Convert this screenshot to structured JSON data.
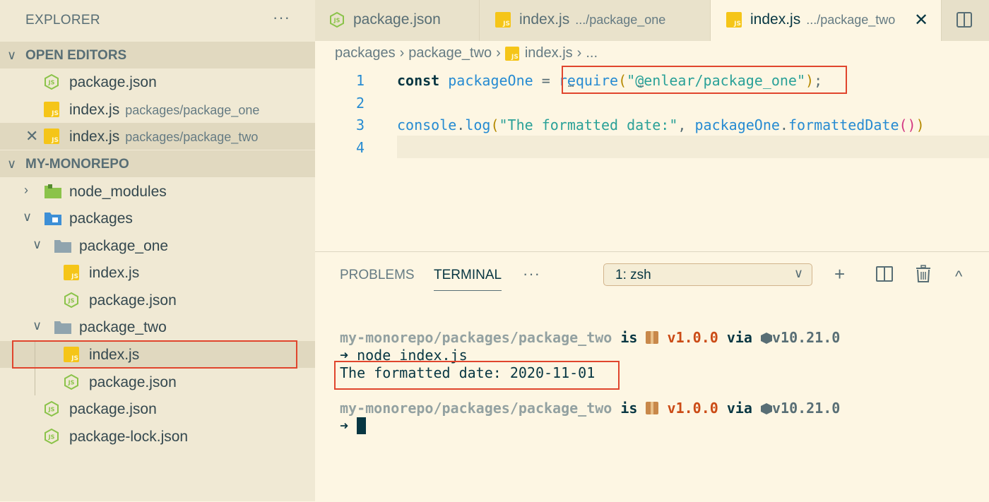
{
  "sidebar": {
    "title": "EXPLORER",
    "more": "···",
    "open_editors": {
      "label": "OPEN EDITORS",
      "items": [
        {
          "name": "package.json",
          "desc": ""
        },
        {
          "name": "index.js",
          "desc": "packages/package_one"
        },
        {
          "name": "index.js",
          "desc": "packages/package_two",
          "close": "✕"
        }
      ]
    },
    "workspace": {
      "label": "MY-MONOREPO",
      "items": {
        "node_modules": "node_modules",
        "packages": "packages",
        "package_one": "package_one",
        "p1_index": "index.js",
        "p1_package": "package.json",
        "package_two": "package_two",
        "p2_index": "index.js",
        "p2_package": "package.json",
        "root_package": "package.json",
        "root_lock": "package-lock.json"
      }
    }
  },
  "tabs": [
    {
      "label": "package.json",
      "desc": ""
    },
    {
      "label": "index.js",
      "desc": ".../package_one"
    },
    {
      "label": "index.js",
      "desc": ".../package_two",
      "close": "✕"
    }
  ],
  "breadcrumb": {
    "parts": [
      "packages",
      "package_two",
      "index.js",
      "..."
    ],
    "sep": "›"
  },
  "editor": {
    "line_numbers": [
      "1",
      "2",
      "3",
      "4"
    ],
    "line1": {
      "kw": "const",
      "var": "packageOne",
      "eq": " = ",
      "fn": "require",
      "open": "(",
      "str": "\"@enlear/package_one\"",
      "close": ")",
      "semi": ";"
    },
    "line3": {
      "obj": "console",
      "dot": ".",
      "fn": "log",
      "open": "(",
      "str": "\"The formatted date:\"",
      "comma": ", ",
      "obj2": "packageOne",
      "dot2": ".",
      "fn2": "formattedDate",
      "parens": "()",
      "close": ")"
    }
  },
  "panel": {
    "tabs": [
      "PROBLEMS",
      "TERMINAL"
    ],
    "more": "···",
    "terminal_select": "1: zsh",
    "add": "+",
    "collapse": "^"
  },
  "terminal": {
    "prompt1": {
      "path": "my-monorepo/packages/package_two",
      "is": " is ",
      "ver": "v1.0.0",
      "via": " via ",
      "node": "v10.21.0"
    },
    "cmd_arrow": "➜",
    "cmd": " node index.js",
    "output": "The formatted date: 2020-11-01",
    "prompt2": {
      "path": "my-monorepo/packages/package_two",
      "is": " is ",
      "ver": "v1.0.0",
      "via": " via ",
      "node": "v10.21.0"
    },
    "arrow2": "➜"
  },
  "colors": {
    "accent": "#268bd2",
    "highlight_box": "#e0452d",
    "js_icon": "#f5c518",
    "json_icon": "#8bc34a"
  }
}
